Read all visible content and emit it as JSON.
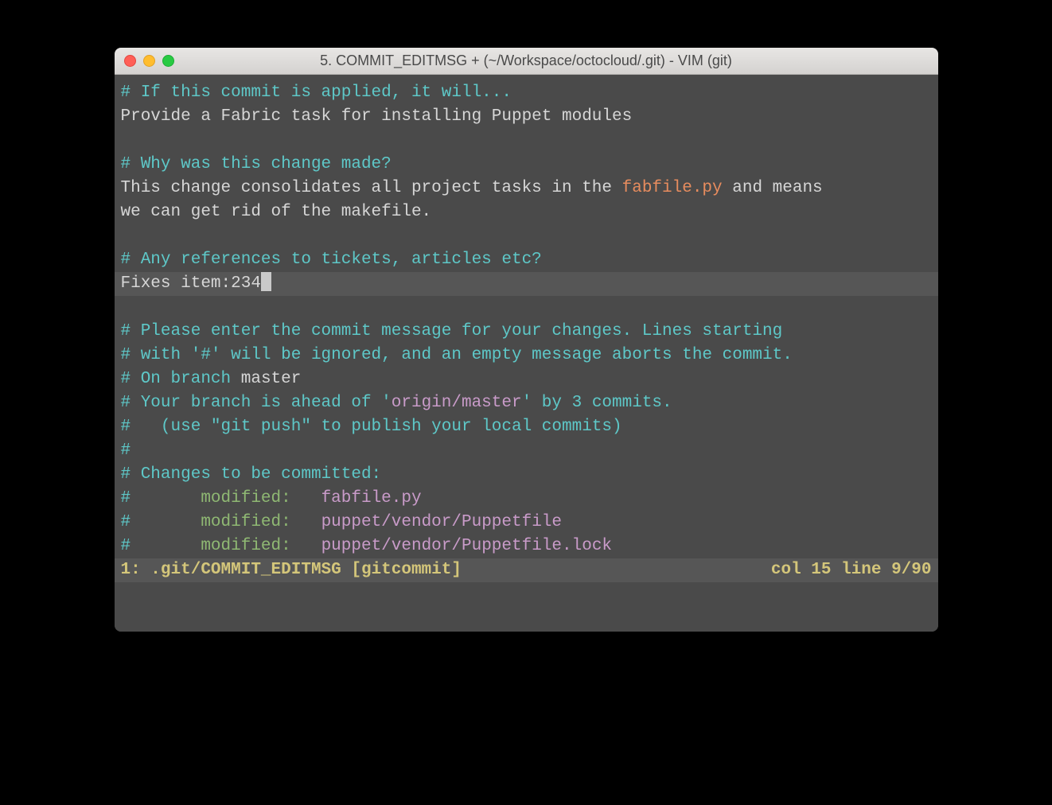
{
  "window": {
    "title": "5. COMMIT_EDITMSG + (~/Workspace/octocloud/.git) - VIM (git)"
  },
  "editor": {
    "l1_comment": "# If this commit is applied, it will...",
    "l2_text": "Provide a Fabric task for installing Puppet modules",
    "l4_comment": "# Why was this change made?",
    "l5_text_a": "This change consolidates all project tasks in the ",
    "l5_file": "fabfile.py",
    "l5_text_b": " and means",
    "l6_text": "we can get rid of the makefile.",
    "l8_comment": "# Any references to tickets, articles etc?",
    "l9_text": "Fixes item:234",
    "l11_comment": "# Please enter the commit message for your changes. Lines starting",
    "l12_comment": "# with '#' will be ignored, and an empty message aborts the commit.",
    "l13_a": "# On branch ",
    "l13_branch": "master",
    "l14_a": "# Your branch is ahead of ",
    "l14_quote1": "'",
    "l14_remote": "origin/master",
    "l14_quote2": "'",
    "l14_b": " by 3 commits.",
    "l15_comment": "#   (use \"git push\" to publish your local commits)",
    "l16_comment": "#",
    "l17_comment": "# Changes to be committed:",
    "l18_hash": "#",
    "l18_mod": "       modified:   ",
    "l18_file": "fabfile.py",
    "l19_hash": "#",
    "l19_mod": "       modified:   ",
    "l19_file": "puppet/vendor/Puppetfile",
    "l20_hash": "#",
    "l20_mod": "       modified:   ",
    "l20_file": "puppet/vendor/Puppetfile.lock"
  },
  "status": {
    "left": "1: .git/COMMIT_EDITMSG [gitcommit]",
    "right": "col 15 line 9/90"
  }
}
